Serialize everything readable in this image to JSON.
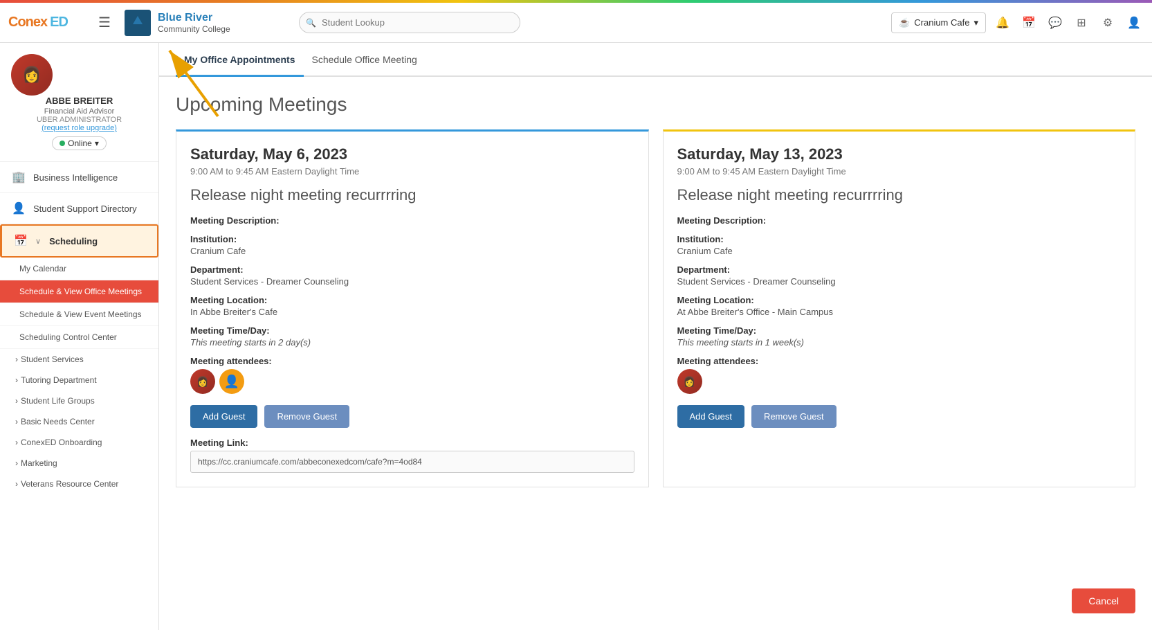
{
  "topbar": {
    "logo": "ConexED",
    "hamburger_label": "☰",
    "college_name_top": "Blue River",
    "college_name_bottom": "Community College",
    "search_placeholder": "Student Lookup",
    "cranium_cafe_label": "Cranium Cafe"
  },
  "sidebar": {
    "profile": {
      "name": "ABBE BREITER",
      "role": "Financial Aid Advisor",
      "admin": "UBER ADMINISTRATOR",
      "request_link": "(request role upgrade)",
      "status": "Online"
    },
    "nav_items": [
      {
        "label": "Business Intelligence",
        "icon": "🏢"
      },
      {
        "label": "Student Support Directory",
        "icon": "👤"
      },
      {
        "label": "Scheduling",
        "icon": "📅",
        "active": true
      }
    ],
    "sub_nav": [
      {
        "label": "My Calendar"
      },
      {
        "label": "Schedule & View Office Meetings",
        "active": true
      },
      {
        "label": "Schedule & View Event Meetings"
      },
      {
        "label": "Scheduling Control Center"
      }
    ],
    "sub_sections": [
      {
        "label": "Student Services"
      },
      {
        "label": "Tutoring Department"
      },
      {
        "label": "Student Life Groups"
      },
      {
        "label": "Basic Needs Center"
      },
      {
        "label": "ConexED Onboarding"
      },
      {
        "label": "Marketing"
      },
      {
        "label": "Veterans Resource Center"
      }
    ]
  },
  "tabs": [
    {
      "label": "My Office Appointments",
      "active": true
    },
    {
      "label": "Schedule Office Meeting",
      "active": false
    }
  ],
  "page": {
    "title": "Upcoming Meetings"
  },
  "meetings": [
    {
      "date": "Saturday, May 6, 2023",
      "time": "9:00 AM to 9:45 AM Eastern Daylight Time",
      "title": "Release night meeting recurrrring",
      "description_label": "Meeting Description:",
      "description_value": "",
      "institution_label": "Institution:",
      "institution": "Cranium Cafe",
      "department_label": "Department:",
      "department": "Student Services - Dreamer Counseling",
      "location_label": "Meeting Location:",
      "location": "In Abbe Breiter's Cafe",
      "time_day_label": "Meeting Time/Day:",
      "time_day": "This meeting starts in 2 day(s)",
      "attendees_label": "Meeting attendees:",
      "add_guest_label": "Add Guest",
      "remove_guest_label": "Remove Guest",
      "link_label": "Meeting Link:",
      "link_value": "https://cc.craniumcafe.com/abbeconexedcom/cafe?m=4od84"
    },
    {
      "date": "Saturday, May 13, 2023",
      "time": "9:00 AM to 9:45 AM Eastern Daylight Time",
      "title": "Release night meeting recurrrring",
      "description_label": "Meeting Description:",
      "description_value": "",
      "institution_label": "Institution:",
      "institution": "Cranium Cafe",
      "department_label": "Department:",
      "department": "Student Services - Dreamer Counseling",
      "location_label": "Meeting Location:",
      "location": "At Abbe Breiter's Office - Main Campus",
      "time_day_label": "Meeting Time/Day:",
      "time_day": "This meeting starts in 1 week(s)",
      "attendees_label": "Meeting attendees:",
      "add_guest_label": "Add Guest",
      "remove_guest_label": "Remove Guest"
    }
  ],
  "cancel_button_label": "Cancel"
}
